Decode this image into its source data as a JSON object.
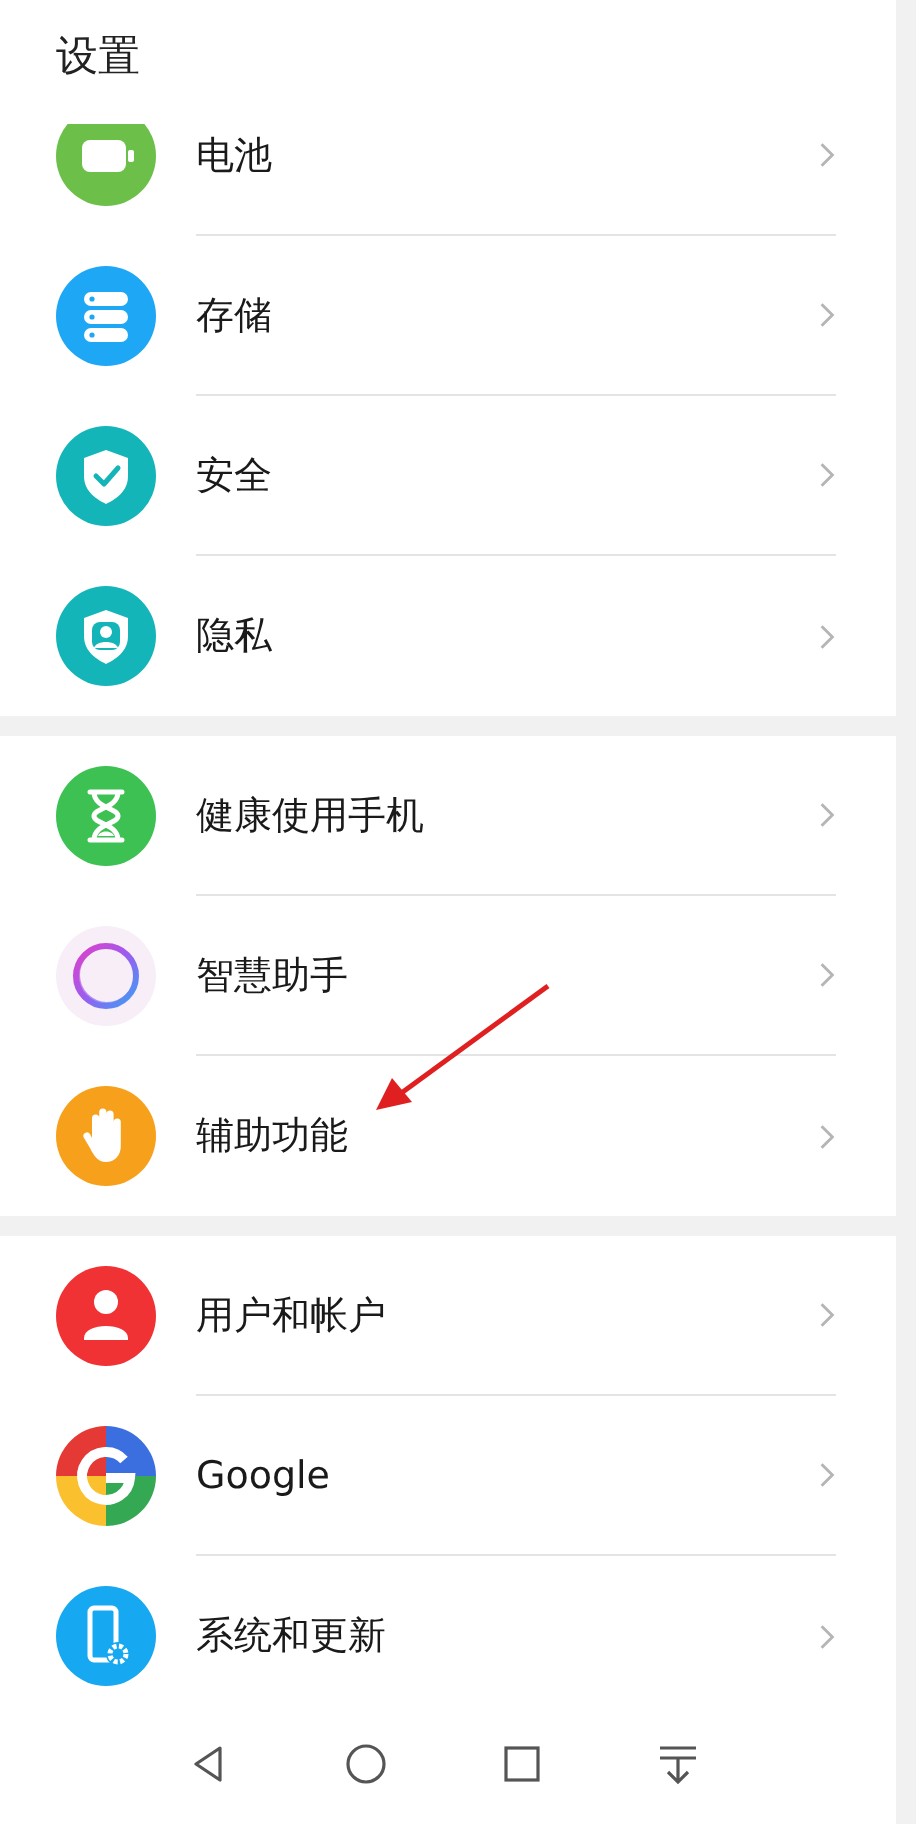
{
  "header": {
    "title": "设置"
  },
  "groups": [
    {
      "items": [
        {
          "kind": "battery",
          "label": "电池"
        },
        {
          "kind": "storage",
          "label": "存储"
        },
        {
          "kind": "security",
          "label": "安全"
        },
        {
          "kind": "privacy",
          "label": "隐私"
        }
      ]
    },
    {
      "items": [
        {
          "kind": "hourglass",
          "label": "健康使用手机"
        },
        {
          "kind": "assistant",
          "label": "智慧助手"
        },
        {
          "kind": "accessibility",
          "label": "辅助功能"
        }
      ]
    },
    {
      "items": [
        {
          "kind": "user",
          "label": "用户和帐户"
        },
        {
          "kind": "google",
          "label": "Google"
        },
        {
          "kind": "system",
          "label": "系统和更新"
        }
      ]
    }
  ],
  "annotation": {
    "kind": "arrow"
  },
  "nav_bar": [
    {
      "kind": "back"
    },
    {
      "kind": "home"
    },
    {
      "kind": "recents"
    },
    {
      "kind": "notifications"
    }
  ]
}
